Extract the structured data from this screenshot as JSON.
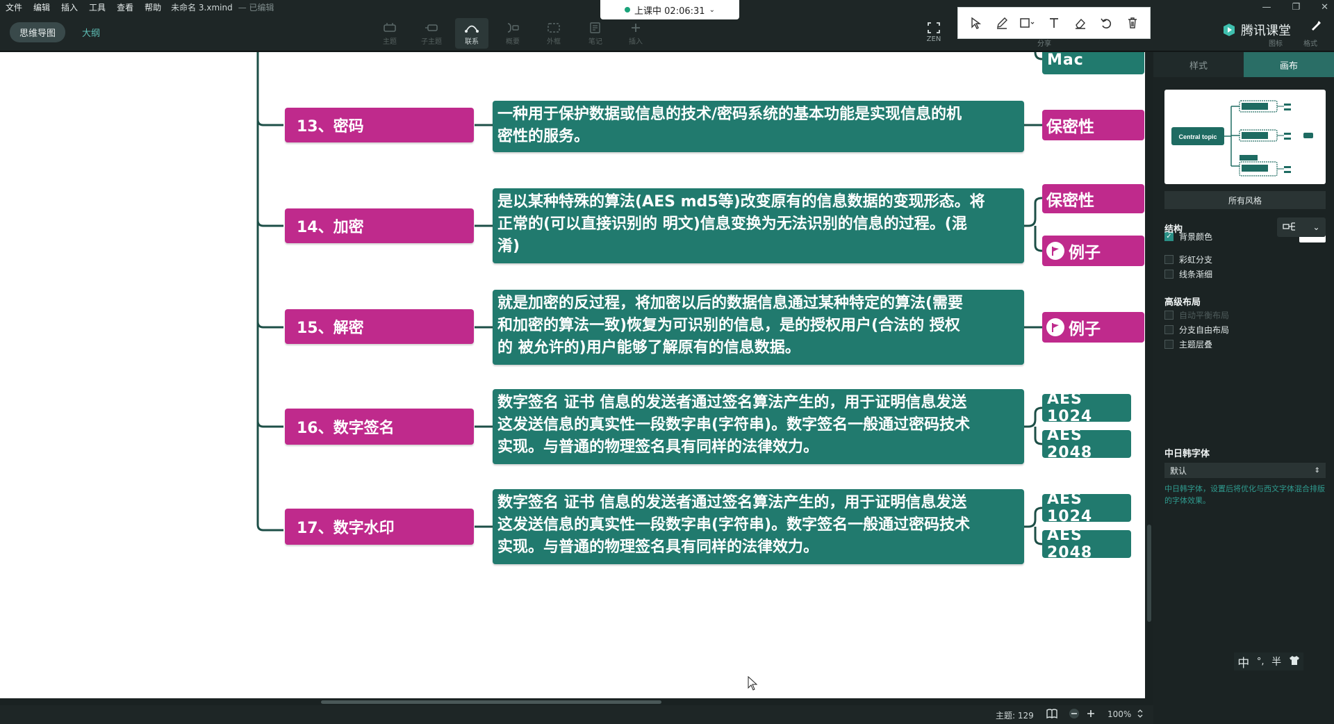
{
  "menu": {
    "items": [
      "文件",
      "编辑",
      "插入",
      "工具",
      "查看",
      "帮助"
    ],
    "doc_name": "未命名 3.xmind",
    "saved_state": "— 已编辑"
  },
  "view_tabs": {
    "mindmap": "思维导图",
    "outline": "大纲"
  },
  "tools": [
    "主题",
    "子主题",
    "联系",
    "概要",
    "外框",
    "笔记",
    "插入"
  ],
  "zen_label": "ZEN",
  "share_label": "分享",
  "icon_label": "图标",
  "format_label": "格式",
  "recording": {
    "status": "上课中 02:06:31"
  },
  "brand": "腾讯课堂",
  "topics": [
    {
      "label": "13、密码",
      "desc_lines": [
        "一种用于保护数据或信息的技术/密码系统的基本功能是实现信息的机",
        "密性的服务。"
      ],
      "tags": [
        {
          "label": "保密性",
          "kind": "magenta"
        }
      ]
    },
    {
      "label": "14、加密",
      "desc_lines": [
        "是以某种特殊的算法(AES md5等)改变原有的信息数据的变现形态。将",
        "正常的(可以直接识别的 明文)信息变换为无法识别的信息的过程。(混",
        "淆)"
      ],
      "tags": [
        {
          "label": "保密性",
          "kind": "magenta"
        },
        {
          "label": "例子",
          "kind": "magenta",
          "flag": true
        }
      ]
    },
    {
      "label": "15、解密",
      "desc_lines": [
        "就是加密的反过程，将加密以后的数据信息通过某种特定的算法(需要",
        "和加密的算法一致)恢复为可识别的信息，是的授权用户(合法的 授权",
        "的 被允许的)用户能够了解原有的信息数据。"
      ],
      "tags": [
        {
          "label": "例子",
          "kind": "magenta",
          "flag": true
        }
      ]
    },
    {
      "label": "16、数字签名",
      "desc_lines": [
        "数字签名 证书 信息的发送者通过签名算法产生的，用于证明信息发送",
        "这发送信息的真实性一段数字串(字符串)。数字签名一般通过密码技术",
        "实现。与普通的物理签名具有同样的法律效力。"
      ],
      "tags": [
        {
          "label": "AES 1024",
          "kind": "green"
        },
        {
          "label": "AES 2048",
          "kind": "green"
        }
      ]
    },
    {
      "label": "17、数字水印",
      "desc_lines": [
        "数字签名 证书 信息的发送者通过签名算法产生的，用于证明信息发送",
        "这发送信息的真实性一段数字串(字符串)。数字签名一般通过密码技术",
        "实现。与普通的物理签名具有同样的法律效力。"
      ],
      "tags": [
        {
          "label": "AES 1024",
          "kind": "green"
        },
        {
          "label": "AES 2048",
          "kind": "green"
        }
      ]
    }
  ],
  "top_partial_tag": "Mac",
  "colors": {
    "topic": "#bf2a8c",
    "desc": "#217a6e",
    "branch": "#1d4f47",
    "accent": "#2a6e66"
  },
  "status": {
    "topics_count": "主题: 129",
    "zoom": "100%"
  },
  "panel": {
    "tabs": [
      "样式",
      "画布"
    ],
    "active_tab": "画布",
    "thumb_central": "Central topic",
    "all_styles": "所有风格",
    "bg_color_label": "背景颜色",
    "structure_label": "结构",
    "rainbow_label": "彩虹分支",
    "taper_label": "线条渐细",
    "advanced_label": "高级布局",
    "auto_balance_label": "自动平衡布局",
    "free_layout_label": "分支自由布局",
    "overlap_label": "主题层叠",
    "cjk_font_label": "中日韩字体",
    "font_value": "默认",
    "font_hint": "中日韩字体，设置后将优化与西文字体混合排版的字体效果。"
  },
  "ime": {
    "lang": "中",
    "punct": "°,",
    "width": "半"
  }
}
